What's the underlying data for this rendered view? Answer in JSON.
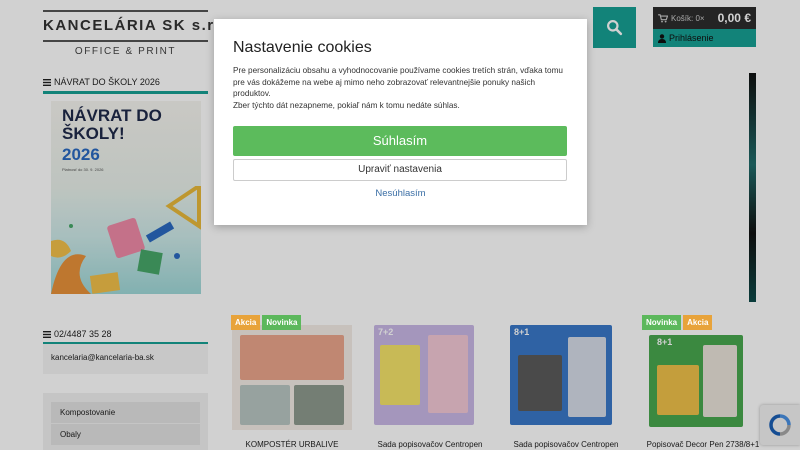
{
  "header": {
    "logo_title": "KANCELÁRIA SK s.r.o.",
    "logo_subtitle": "OFFICE & PRINT",
    "cart_label": "Košík: 0×",
    "cart_price": "0,00 €",
    "login_label": "Prihlásenie"
  },
  "sidebar": {
    "banner_heading": "NÁVRAT DO ŠKOLY 2026",
    "banner_title": "NÁVRAT DO ŠKOLY!",
    "banner_year": "2026",
    "banner_small": "Platnosť do 30. 9. 2026",
    "phone": "02/4487 35 28",
    "email": "kancelaria@kancelaria-ba.sk",
    "categories": [
      "Kompostovanie",
      "Obaly"
    ]
  },
  "products": [
    {
      "name": "KOMPOSTÉR URBALIVE",
      "badges": [
        {
          "label": "Akcia",
          "color": "#e8a33a"
        },
        {
          "label": "Novinka",
          "color": "#5cb85c"
        }
      ]
    },
    {
      "name": "Sada popisovačov Centropen",
      "badges": []
    },
    {
      "name": "Sada popisovačov Centropen",
      "badges": []
    },
    {
      "name": "Popisovač Decor Pen 2738/8+1",
      "badges": [
        {
          "label": "Novinka",
          "color": "#5cb85c"
        },
        {
          "label": "Akcia",
          "color": "#e8a33a"
        }
      ]
    }
  ],
  "product_box_labels": [
    "7+2",
    "8+1",
    "8+1"
  ],
  "cookie_modal": {
    "title": "Nastavenie cookies",
    "text_1": "Pre personalizáciu obsahu a vyhodnocovanie používame cookies tretích strán, vďaka tomu pre vás dokážeme na webe aj mimo neho zobrazovať relevantnejšie ponuky našich produktov.",
    "text_2": "Zber týchto dát nezapneme, pokiaľ nám k tomu nedáte súhlas.",
    "accept_label": "Súhlasím",
    "settings_label": "Upraviť nastavenia",
    "reject_label": "Nesúhlasím"
  },
  "colors": {
    "accent": "#17a094",
    "accept": "#5cbb5c",
    "badge_akcia": "#e8a33a",
    "badge_novinka": "#5cb85c"
  },
  "icons": {
    "search": "search-icon",
    "cart": "cart-icon",
    "user": "user-icon",
    "menu": "menu-icon",
    "recaptcha": "recaptcha-icon"
  }
}
